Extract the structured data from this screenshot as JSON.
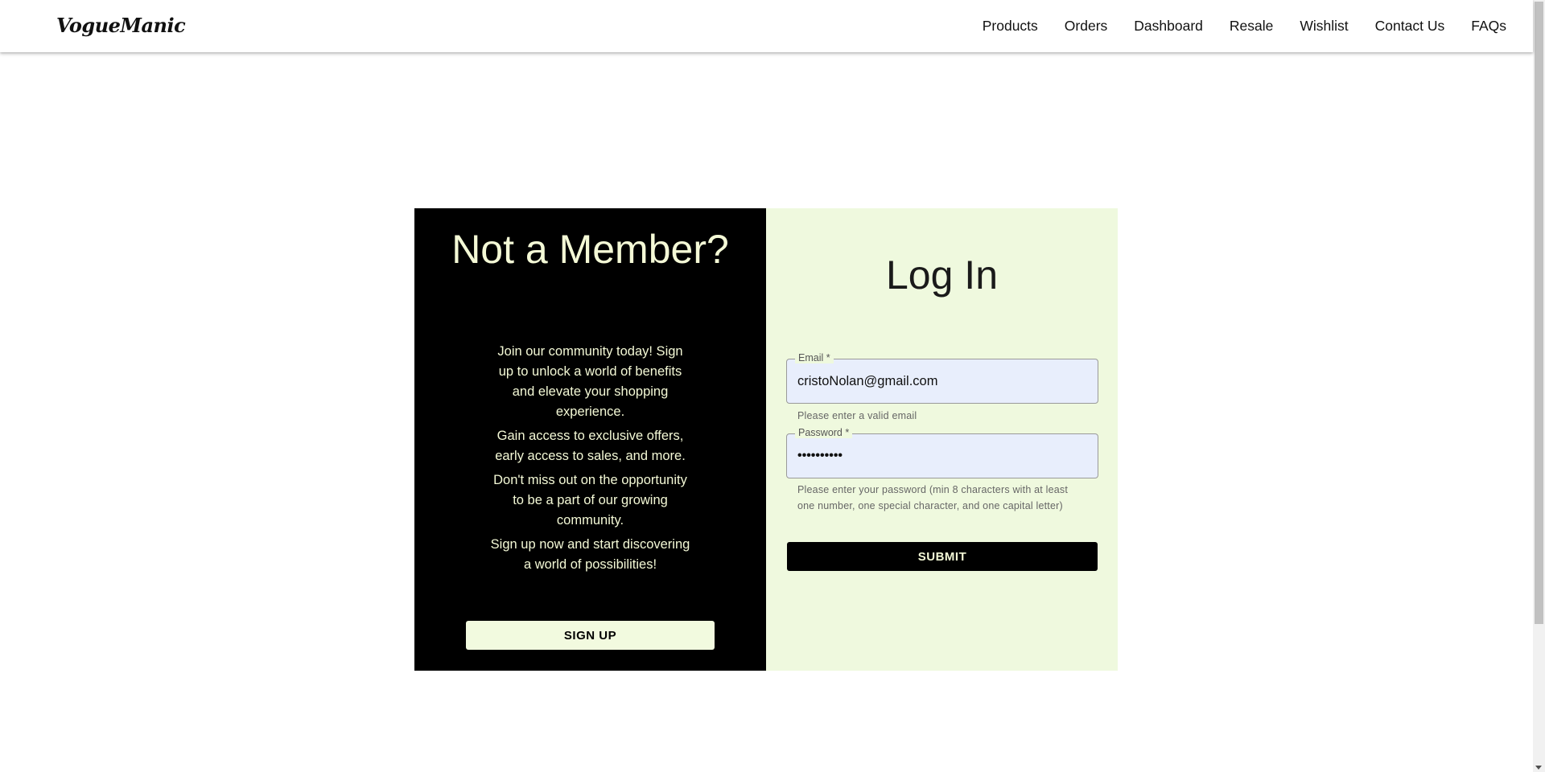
{
  "brand": {
    "logo": "VogueManic"
  },
  "nav": {
    "items": [
      {
        "label": "Products"
      },
      {
        "label": "Orders"
      },
      {
        "label": "Dashboard"
      },
      {
        "label": "Resale"
      },
      {
        "label": "Wishlist"
      },
      {
        "label": "Contact Us"
      },
      {
        "label": "FAQs"
      }
    ]
  },
  "signup_panel": {
    "title": "Not a Member?",
    "paragraphs": [
      "Join our community today! Sign up to unlock a world of benefits and elevate your shopping experience.",
      "Gain access to exclusive offers, early access to sales, and more.",
      "Don't miss out on the opportunity to be a part of our growing community.",
      "Sign up now and start discovering a world of possibilities!"
    ],
    "button_label": "SIGN UP"
  },
  "login_panel": {
    "title": "Log In",
    "email": {
      "label": "Email *",
      "value": "cristoNolan@gmail.com",
      "helper": "Please enter a valid email"
    },
    "password": {
      "label": "Password *",
      "value": "••••••••••",
      "helper": "Please enter your password (min 8 characters with at least one number, one special character, and one capital letter)"
    },
    "submit_label": "SUBMIT"
  },
  "colors": {
    "left_panel_bg": "#000000",
    "left_panel_text": "#f4f9d6",
    "right_panel_bg": "#eff9de",
    "input_bg": "#e8eefc"
  }
}
